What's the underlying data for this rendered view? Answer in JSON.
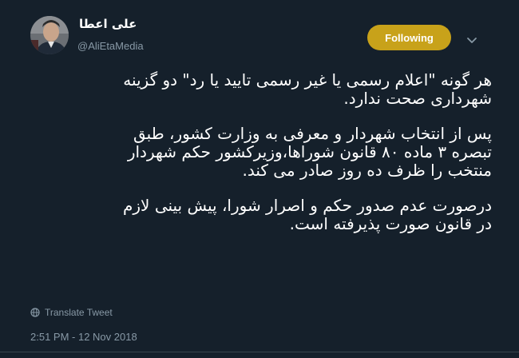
{
  "author": {
    "display_name": "علی اعطا",
    "handle": "@AliEtaMedia"
  },
  "follow_button": {
    "label": "Following"
  },
  "tweet": {
    "paragraphs": [
      {
        "lines": [
          "هر گونه \"اعلام رسمی یا غیر رسمی تایید یا رد\" دو گزینه",
          "شهرداری صحت ندارد."
        ]
      },
      {
        "lines": [
          "پس از انتخاب شهردار و معرفی به وزارت  کشور، طبق",
          "تبصره ۳ ماده ۸۰ قانون شوراها،وزیرکشور حکم شهردار",
          "منتخب را ظرف ده روز صادر می کند."
        ]
      },
      {
        "lines": [
          "درصورت عدم صدور حکم و اصرار شورا، پیش بینی لازم",
          "در  قانون صورت پذیرفته است."
        ]
      }
    ]
  },
  "translate": {
    "label": "Translate Tweet",
    "icon": "globe-icon"
  },
  "timestamp": "2:51 PM - 12 Nov 2018",
  "icons": {
    "caret": "chevron-down-icon",
    "avatar": "avatar"
  },
  "colors": {
    "background": "#15202b",
    "following_button": "#c8a21a",
    "secondary_text": "#8899a6",
    "primary_text": "#ffffff"
  }
}
